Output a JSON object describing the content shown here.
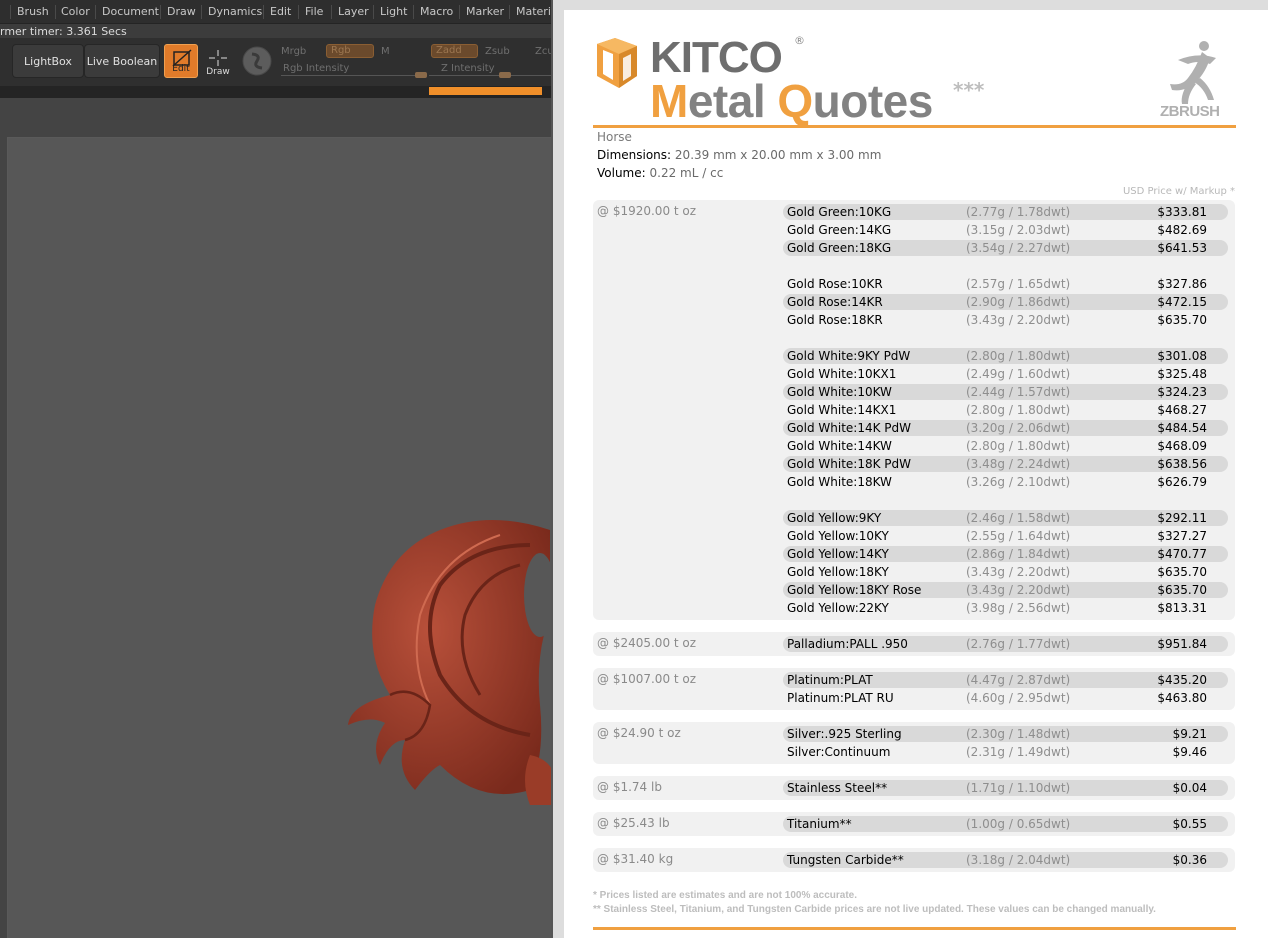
{
  "app": {
    "menu": [
      "Brush",
      "Color",
      "Document",
      "Draw",
      "Dynamics",
      "Edit",
      "File",
      "Layer",
      "Light",
      "Macro",
      "Marker",
      "Materia"
    ],
    "timer": "rmer timer: 3.361 Secs",
    "buttons": {
      "lightbox": "LightBox",
      "live_boolean": "Live Boolean",
      "edit": "Edit",
      "draw": "Draw"
    },
    "labels": {
      "mrgb": "Mrgb",
      "rgb": "Rgb",
      "m": "M",
      "rgb_intensity": "Rgb Intensity",
      "zadd": "Zadd",
      "zsub": "Zsub",
      "zcut": "Zcu",
      "z_intensity": "Z Intensity"
    }
  },
  "kitco": {
    "brand": "KITCO",
    "reg": "®",
    "title_parts": [
      "M",
      "etal ",
      "Q",
      "uotes"
    ],
    "stars": "***",
    "zbrush": "ZBRUSH",
    "model_name": "Horse",
    "dimensions_label": "Dimensions:",
    "dimensions_value": "20.39 mm x 20.00 mm x 3.00 mm",
    "volume_label": "Volume:",
    "volume_value": "0.22 mL / cc",
    "usd_note": "USD Price w/ Markup *",
    "groups": [
      {
        "price": "@ $1920.00 t oz",
        "rows": [
          {
            "name": "Gold Green:10KG",
            "weight": "(2.77g / 1.78dwt)",
            "price": "$333.81"
          },
          {
            "name": "Gold Green:14KG",
            "weight": "(3.15g / 2.03dwt)",
            "price": "$482.69"
          },
          {
            "name": "Gold Green:18KG",
            "weight": "(3.54g / 2.27dwt)",
            "price": "$641.53"
          },
          {
            "name": "Gold Rose:10KR",
            "weight": "(2.57g / 1.65dwt)",
            "price": "$327.86"
          },
          {
            "name": "Gold Rose:14KR",
            "weight": "(2.90g / 1.86dwt)",
            "price": "$472.15"
          },
          {
            "name": "Gold Rose:18KR",
            "weight": "(3.43g / 2.20dwt)",
            "price": "$635.70"
          },
          {
            "name": "Gold White:9KY PdW",
            "weight": "(2.80g / 1.80dwt)",
            "price": "$301.08"
          },
          {
            "name": "Gold White:10KX1",
            "weight": "(2.49g / 1.60dwt)",
            "price": "$325.48"
          },
          {
            "name": "Gold White:10KW",
            "weight": "(2.44g / 1.57dwt)",
            "price": "$324.23"
          },
          {
            "name": "Gold White:14KX1",
            "weight": "(2.80g / 1.80dwt)",
            "price": "$468.27"
          },
          {
            "name": "Gold White:14K PdW",
            "weight": "(3.20g / 2.06dwt)",
            "price": "$484.54"
          },
          {
            "name": "Gold White:14KW",
            "weight": "(2.80g / 1.80dwt)",
            "price": "$468.09"
          },
          {
            "name": "Gold White:18K PdW",
            "weight": "(3.48g / 2.24dwt)",
            "price": "$638.56"
          },
          {
            "name": "Gold White:18KW",
            "weight": "(3.26g / 2.10dwt)",
            "price": "$626.79"
          },
          {
            "name": "Gold Yellow:9KY",
            "weight": "(2.46g / 1.58dwt)",
            "price": "$292.11"
          },
          {
            "name": "Gold Yellow:10KY",
            "weight": "(2.55g / 1.64dwt)",
            "price": "$327.27"
          },
          {
            "name": "Gold Yellow:14KY",
            "weight": "(2.86g / 1.84dwt)",
            "price": "$470.77"
          },
          {
            "name": "Gold Yellow:18KY",
            "weight": "(3.43g / 2.20dwt)",
            "price": "$635.70"
          },
          {
            "name": "Gold Yellow:18KY Rose",
            "weight": "(3.43g / 2.20dwt)",
            "price": "$635.70"
          },
          {
            "name": "Gold Yellow:22KY",
            "weight": "(3.98g / 2.56dwt)",
            "price": "$813.31"
          }
        ]
      },
      {
        "price": "@ $2405.00 t oz",
        "rows": [
          {
            "name": "Palladium:PALL .950",
            "weight": "(2.76g / 1.77dwt)",
            "price": "$951.84"
          }
        ]
      },
      {
        "price": "@ $1007.00 t oz",
        "rows": [
          {
            "name": "Platinum:PLAT",
            "weight": "(4.47g / 2.87dwt)",
            "price": "$435.20"
          },
          {
            "name": "Platinum:PLAT RU",
            "weight": "(4.60g / 2.95dwt)",
            "price": "$463.80"
          }
        ]
      },
      {
        "price": "@ $24.90 t oz",
        "rows": [
          {
            "name": "Silver:.925 Sterling",
            "weight": "(2.30g / 1.48dwt)",
            "price": "$9.21"
          },
          {
            "name": "Silver:Continuum",
            "weight": "(2.31g / 1.49dwt)",
            "price": "$9.46"
          }
        ]
      },
      {
        "price": "@ $1.74 lb",
        "rows": [
          {
            "name": "Stainless Steel**",
            "weight": "(1.71g / 1.10dwt)",
            "price": "$0.04"
          }
        ]
      },
      {
        "price": "@ $25.43 lb",
        "rows": [
          {
            "name": "Titanium**",
            "weight": "(1.00g / 0.65dwt)",
            "price": "$0.55"
          }
        ]
      },
      {
        "price": "@ $31.40 kg",
        "rows": [
          {
            "name": "Tungsten Carbide**",
            "weight": "(3.18g / 2.04dwt)",
            "price": "$0.36"
          }
        ]
      }
    ],
    "footnote1": "* Prices listed are estimates and are not 100% accurate.",
    "footnote2": "** Stainless Steel, Titanium, and Tungsten Carbide prices are not live updated. These values can be changed manually."
  },
  "colors": {
    "accent": "#f0a040",
    "edit_button": "#e07b2a",
    "model": "#a8432e"
  }
}
